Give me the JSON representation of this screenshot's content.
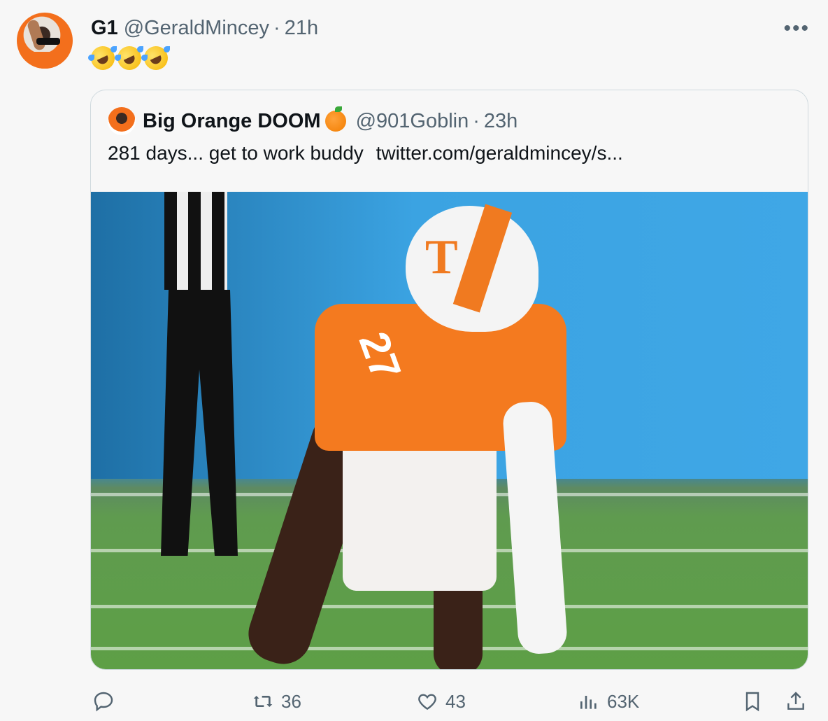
{
  "tweet": {
    "author_name": "G1",
    "author_handle": "@GeraldMincey",
    "separator": "·",
    "time": "21h",
    "more_label": "•••",
    "text_emoji": [
      "rolling-on-floor-laughing",
      "rolling-on-floor-laughing",
      "rolling-on-floor-laughing"
    ]
  },
  "quoted": {
    "author_name": "Big Orange DOOM",
    "author_handle": "@901Goblin",
    "separator": "·",
    "time": "23h",
    "text": "281 days... get to work buddy",
    "link": "twitter.com/geraldmincey/s..."
  },
  "actions": {
    "reply_count": "",
    "retweet_count": "36",
    "like_count": "43",
    "views_count": "63K"
  },
  "colors": {
    "accent_orange": "#f47a1f",
    "text_primary": "#0f1419",
    "text_secondary": "#536471",
    "border": "#cfd9de"
  }
}
